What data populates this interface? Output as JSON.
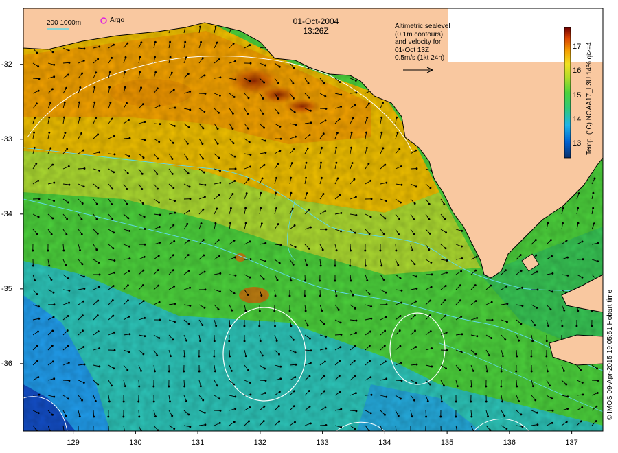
{
  "map": {
    "title_date": "01-Oct-2004",
    "title_time": "13:26Z",
    "legend_lines": [
      "Altimetric sealevel",
      "(0.1m contours)",
      "and velocity for",
      "01-Oct 13Z",
      "0.5m/s (1kt 24h)"
    ],
    "scale_bar_label": "200  1000m",
    "argo_label": "Argo",
    "colorbar_title": "Temp. (°C) NOAA17_L3U 14% qi>=4",
    "colorbar_ticks": [
      "17",
      "16",
      "15",
      "14",
      "13"
    ],
    "colorbar_range": [
      12.4,
      17.8
    ],
    "credit": "© IMOS 09-Apr-2015 19:05:51 Hobart time",
    "x_ticks": [
      "129",
      "130",
      "131",
      "132",
      "133",
      "134",
      "135",
      "136",
      "137"
    ],
    "y_ticks": [
      "-32",
      "-33",
      "-34",
      "-35",
      "-36"
    ],
    "lon_range": [
      128.2,
      137.5
    ],
    "lat_range": [
      -36.9,
      -31.25
    ],
    "colors": {
      "land": "#f9c8a0",
      "sst_cold": "#1e90ff",
      "sst_mid": "#4cd23c",
      "sst_warm": "#f0b400",
      "sst_hot": "#8b1a00",
      "contour": "#ffffff",
      "isobath": "#5fd9e8",
      "argo": "#e020e0"
    }
  }
}
